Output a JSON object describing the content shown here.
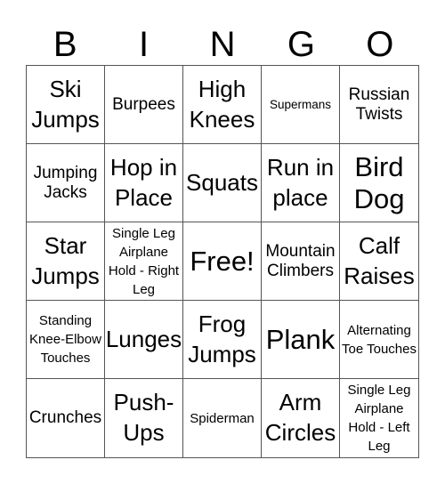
{
  "header": [
    "B",
    "I",
    "N",
    "G",
    "O"
  ],
  "cells": [
    {
      "text": "Ski Jumps",
      "size": "l"
    },
    {
      "text": "Burpees",
      "size": "m"
    },
    {
      "text": "High Knees",
      "size": "l"
    },
    {
      "text": "Supermans",
      "size": "xs"
    },
    {
      "text": "Russian Twists",
      "size": "m"
    },
    {
      "text": "Jumping Jacks",
      "size": "m"
    },
    {
      "text": "Hop in Place",
      "size": "l"
    },
    {
      "text": "Squats",
      "size": "l"
    },
    {
      "text": "Run in place",
      "size": "l"
    },
    {
      "text": "Bird Dog",
      "size": "xl"
    },
    {
      "text": "Star Jumps",
      "size": "l"
    },
    {
      "text": "Single Leg Airplane Hold - Right Leg",
      "size": "s"
    },
    {
      "text": "Free!",
      "size": "xl",
      "free": true
    },
    {
      "text": "Mountain Climbers",
      "size": "m"
    },
    {
      "text": "Calf Raises",
      "size": "l"
    },
    {
      "text": "Standing Knee-Elbow Touches",
      "size": "s"
    },
    {
      "text": "Lunges",
      "size": "l"
    },
    {
      "text": "Frog Jumps",
      "size": "l"
    },
    {
      "text": "Plank",
      "size": "xl"
    },
    {
      "text": "Alternating Toe Touches",
      "size": "s"
    },
    {
      "text": "Crunches",
      "size": "m"
    },
    {
      "text": "Push-Ups",
      "size": "l"
    },
    {
      "text": "Spiderman",
      "size": "s"
    },
    {
      "text": "Arm Circles",
      "size": "l"
    },
    {
      "text": "Single Leg Airplane Hold - Left Leg",
      "size": "s"
    }
  ]
}
